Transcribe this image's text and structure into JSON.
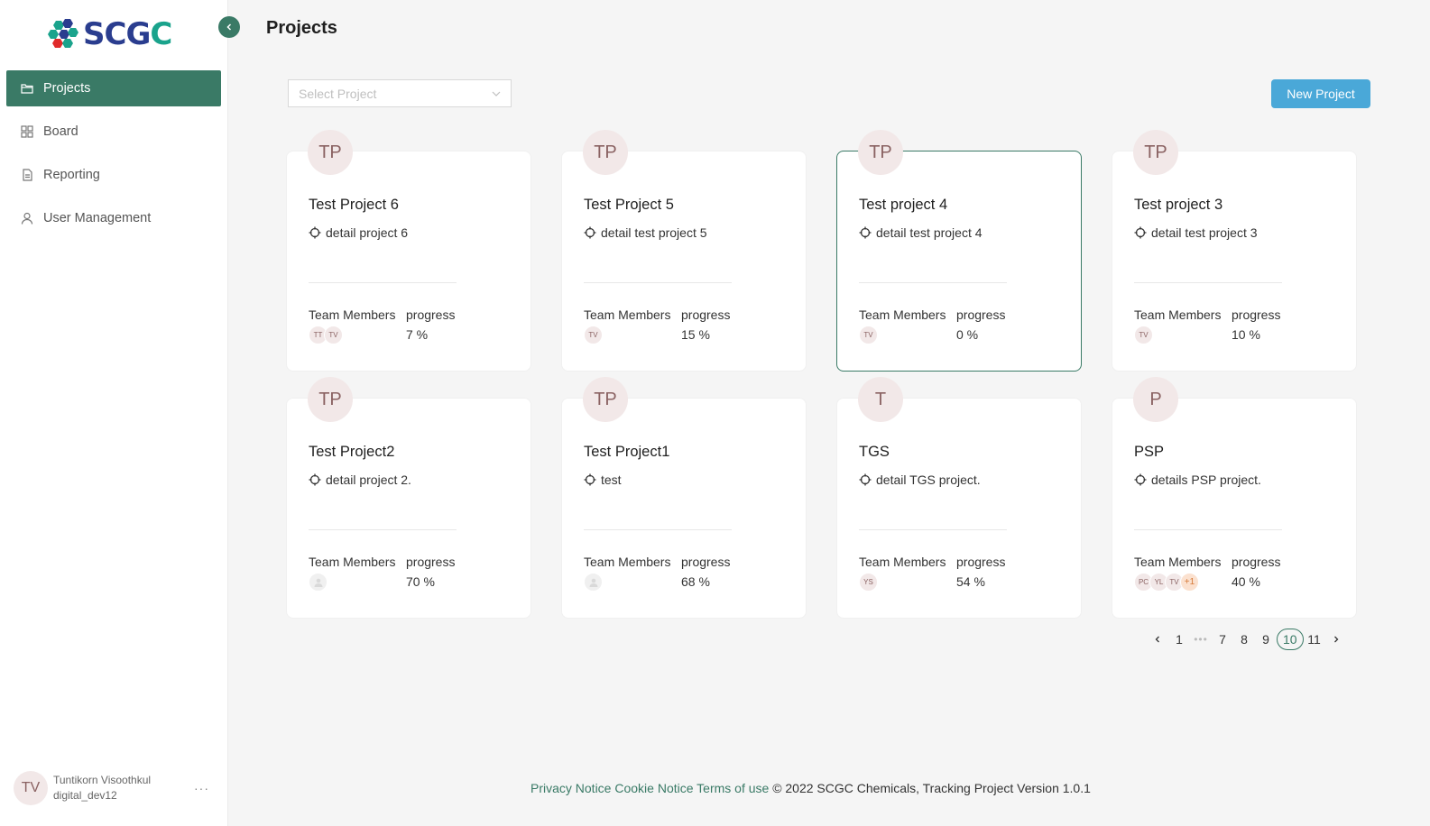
{
  "sidebar": {
    "logo_text_part1": "SCG",
    "logo_text_part2": "C",
    "items": [
      {
        "label": "Projects",
        "icon": "folder-icon",
        "active": true
      },
      {
        "label": "Board",
        "icon": "grid-icon",
        "active": false
      },
      {
        "label": "Reporting",
        "icon": "file-icon",
        "active": false
      },
      {
        "label": "User Management",
        "icon": "user-icon",
        "active": false
      }
    ],
    "user": {
      "initials": "TV",
      "name": "Tuntikorn Visoothkul",
      "username": "digital_dev12",
      "more": "···"
    }
  },
  "header": {
    "title": "Projects"
  },
  "toolbar": {
    "select_placeholder": "Select Project",
    "new_project_label": "New Project"
  },
  "labels": {
    "team_members": "Team Members",
    "progress": "progress"
  },
  "projects": [
    {
      "initials": "TP",
      "name": "Test Project 6",
      "detail": "detail project 6",
      "members": [
        "TT",
        "TV"
      ],
      "progress": "7 %"
    },
    {
      "initials": "TP",
      "name": "Test Project 5",
      "detail": "detail test project 5",
      "members": [
        "TV"
      ],
      "progress": "15 %"
    },
    {
      "initials": "TP",
      "name": "Test project 4",
      "detail": "detail test project 4",
      "members": [
        "TV"
      ],
      "progress": "0 %"
    },
    {
      "initials": "TP",
      "name": "Test project 3",
      "detail": "detail test project 3",
      "members": [
        "TV"
      ],
      "progress": "10 %"
    },
    {
      "initials": "TP",
      "name": "Test Project2",
      "detail": "detail project 2.",
      "members": [],
      "progress": "70 %"
    },
    {
      "initials": "TP",
      "name": "Test Project1",
      "detail": "test",
      "members": [],
      "progress": "68 %"
    },
    {
      "initials": "T",
      "name": "TGS",
      "detail": "detail TGS project.",
      "members": [
        "YS"
      ],
      "progress": "54 %"
    },
    {
      "initials": "P",
      "name": "PSP",
      "detail": "details PSP project.",
      "members": [
        "PC",
        "YL",
        "TV"
      ],
      "more": "+1",
      "progress": "40 %"
    }
  ],
  "pagination": {
    "pages": [
      "1",
      "•••",
      "7",
      "8",
      "9",
      "10",
      "11"
    ],
    "current": "10"
  },
  "footer": {
    "privacy": "Privacy Notice",
    "cookie": "Cookie Notice",
    "terms": "Terms of use",
    "copyright": "© 2022 SCGC Chemicals, Tracking Project Version 1.0.1"
  },
  "colors": {
    "primary": "#3a7a66",
    "button": "#4aa8d8",
    "avatar_bg": "#f2e8e8"
  }
}
